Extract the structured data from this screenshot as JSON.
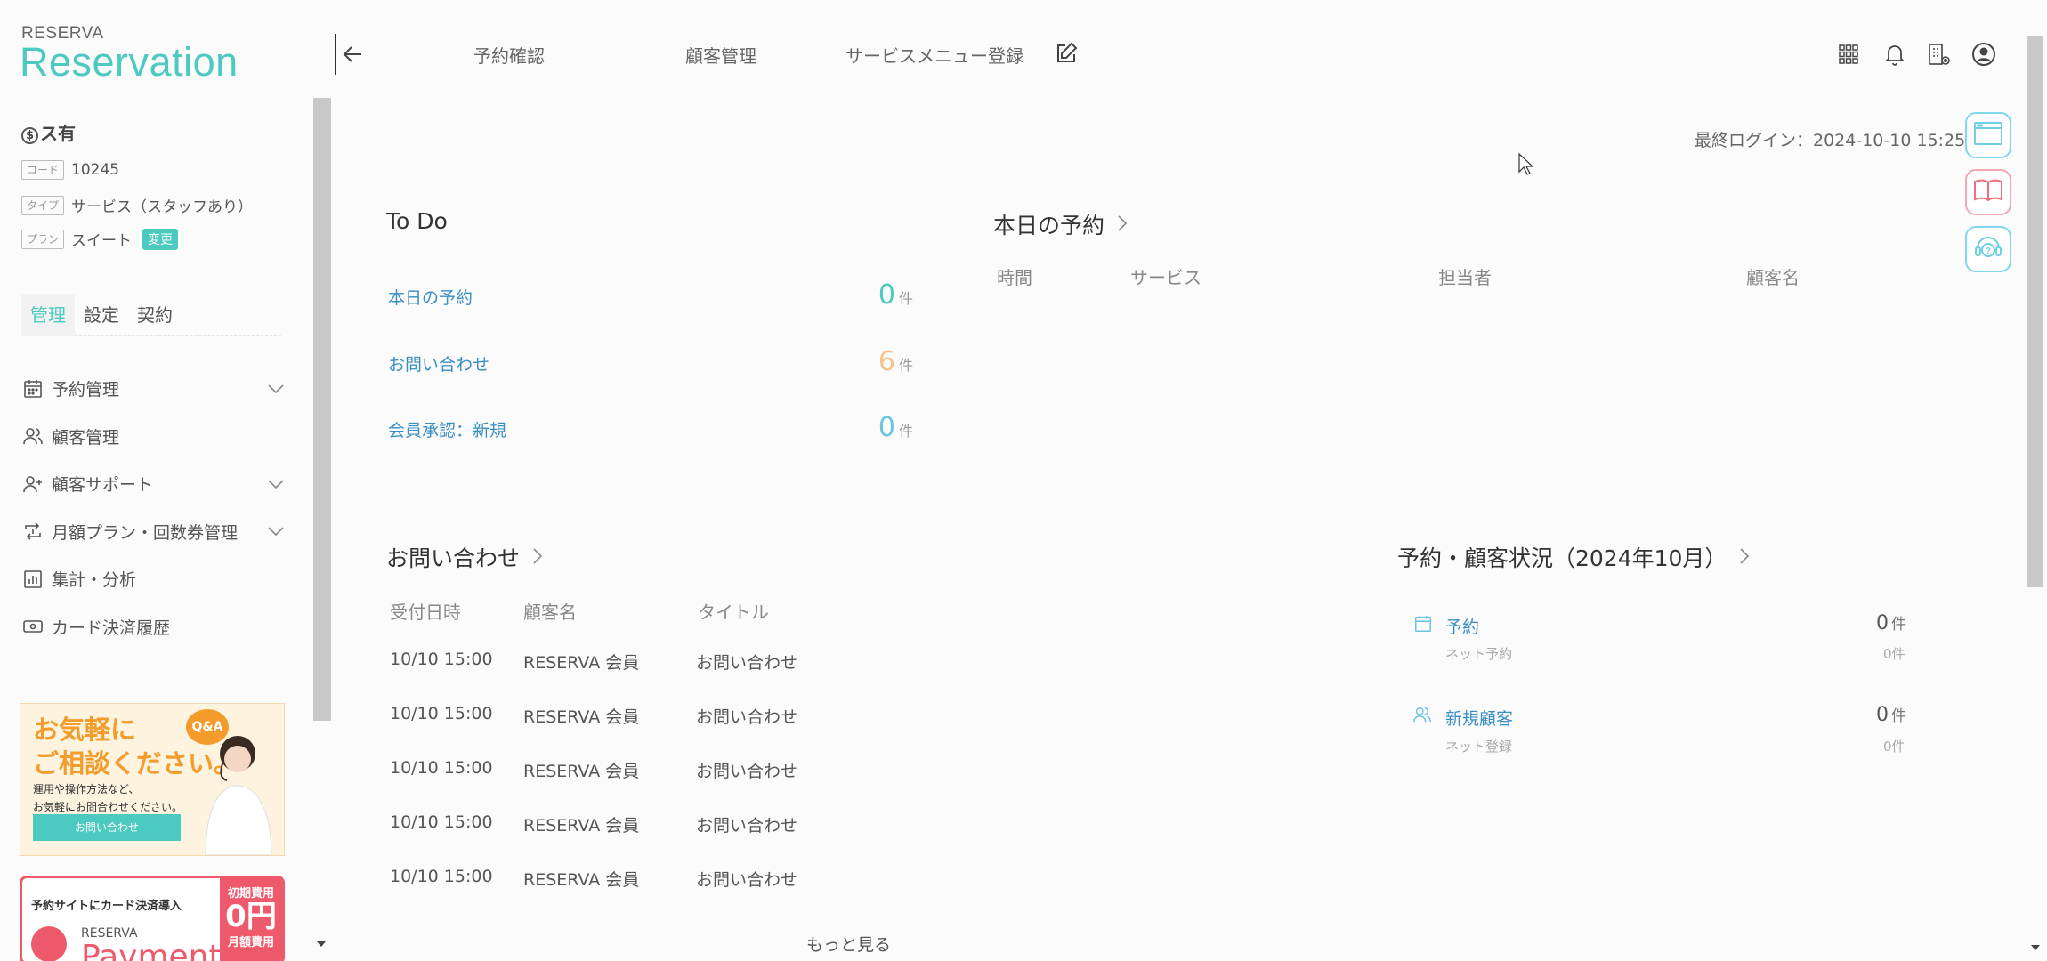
{
  "brand": {
    "small": "RESERVA",
    "big": "Reservation"
  },
  "store": {
    "name": "ス有",
    "code_tag": "コード",
    "code": "10245",
    "type_tag": "タイプ",
    "type": "サービス（スタッフあり）",
    "plan_tag": "プラン",
    "plan": "スイート",
    "change_label": "変更"
  },
  "side_tabs": [
    "管理",
    "設定",
    "契約"
  ],
  "side_menu": [
    {
      "label": "予約管理",
      "icon": "calendar-icon",
      "expandable": true
    },
    {
      "label": "顧客管理",
      "icon": "users-icon",
      "expandable": false
    },
    {
      "label": "顧客サポート",
      "icon": "user-plus-icon",
      "expandable": true
    },
    {
      "label": "月額プラン・回数券管理",
      "icon": "repeat-icon",
      "expandable": true
    },
    {
      "label": "集計・分析",
      "icon": "bar-chart-icon",
      "expandable": false
    },
    {
      "label": "カード決済履歴",
      "icon": "money-card-icon",
      "expandable": false
    }
  ],
  "banner_consult": {
    "title_line1": "お気軽に",
    "title_line2": "ご相談ください。",
    "badge": "Q&A",
    "sub_line1": "運用や操作方法など、",
    "sub_line2": "お気軽にお問合わせください。",
    "button": "お問い合わせ"
  },
  "banner_payment": {
    "text": "予約サイトにカード決済導入",
    "brand_small": "RESERVA",
    "brand_big": "Payment",
    "fee_label": "初期費用",
    "fee_value": "0円",
    "monthly_label": "月額費用"
  },
  "header": {
    "nav": [
      "予約確認",
      "顧客管理",
      "サービスメニュー登録"
    ],
    "icons": [
      "apps-grid-icon",
      "bell-icon",
      "building-settings-icon",
      "account-icon"
    ]
  },
  "last_login": "最終ログイン：2024-10-10 15:25",
  "floating_buttons": [
    "browser-window-icon",
    "manual-book-icon",
    "support-headset-icon"
  ],
  "todo": {
    "title": "To Do",
    "unit": "件",
    "items": [
      {
        "label": "本日の予約",
        "count": "0",
        "color": "#4ccac0"
      },
      {
        "label": "お問い合わせ",
        "count": "6",
        "color": "#f6c48a"
      },
      {
        "label": "会員承認：新規",
        "count": "0",
        "color": "#6bc3e3"
      }
    ]
  },
  "today": {
    "title": "本日の予約",
    "columns": [
      "時間",
      "サービス",
      "担当者",
      "顧客名"
    ]
  },
  "inquiries": {
    "title": "お問い合わせ",
    "columns": [
      "受付日時",
      "顧客名",
      "タイトル"
    ],
    "rows": [
      [
        "10/10 15:00",
        "RESERVA 会員",
        "お問い合わせ"
      ],
      [
        "10/10 15:00",
        "RESERVA 会員",
        "お問い合わせ"
      ],
      [
        "10/10 15:00",
        "RESERVA 会員",
        "お問い合わせ"
      ],
      [
        "10/10 15:00",
        "RESERVA 会員",
        "お問い合わせ"
      ],
      [
        "10/10 15:00",
        "RESERVA 会員",
        "お問い合わせ"
      ]
    ],
    "more": "もっと見る"
  },
  "status": {
    "title": "予約・顧客状況（2024年10月）",
    "unit": "件",
    "items": [
      {
        "label": "予約",
        "count": "0",
        "sub_label": "ネット予約",
        "sub_count": "0件"
      },
      {
        "label": "新規顧客",
        "count": "0",
        "sub_label": "ネット登録",
        "sub_count": "0件"
      }
    ]
  }
}
